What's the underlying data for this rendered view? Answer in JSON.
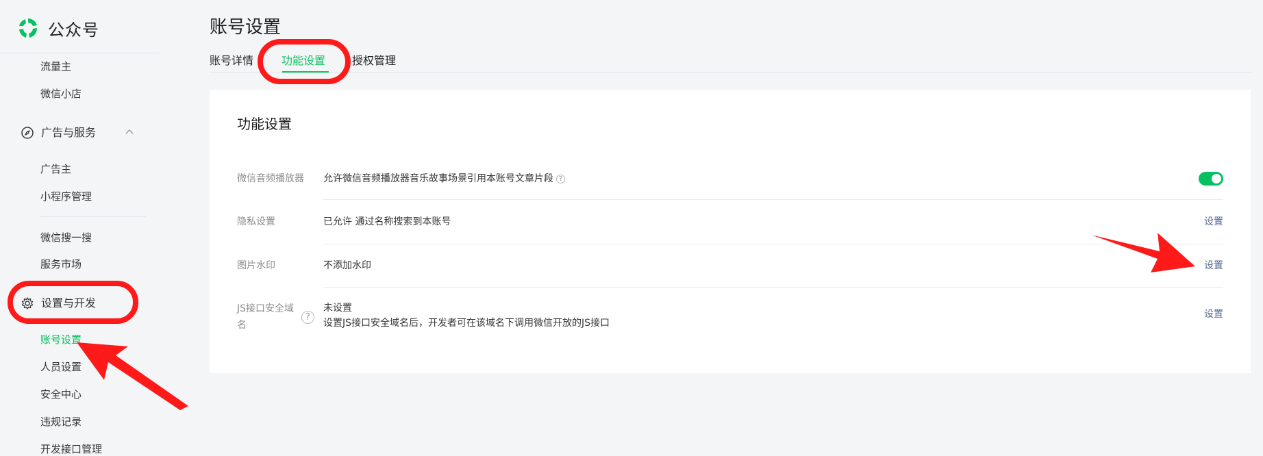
{
  "brand": {
    "name": "公众号",
    "color": "#07c160"
  },
  "sidebar": {
    "items_top": [
      {
        "label": "流量主"
      },
      {
        "label": "微信小店"
      }
    ],
    "group_ads": {
      "label": "广告与服务",
      "icon": "compass-icon",
      "expanded": true
    },
    "ads_items": [
      {
        "label": "广告主"
      },
      {
        "label": "小程序管理"
      },
      {
        "label": "微信搜一搜"
      },
      {
        "label": "服务市场"
      }
    ],
    "group_settings": {
      "label": "设置与开发",
      "icon": "gear-icon"
    },
    "settings_items": [
      {
        "label": "账号设置",
        "active": true
      },
      {
        "label": "人员设置"
      },
      {
        "label": "安全中心"
      },
      {
        "label": "违规记录"
      },
      {
        "label": "开发接口管理"
      }
    ]
  },
  "header": {
    "title": "账号设置",
    "tabs": [
      {
        "label": "账号详情"
      },
      {
        "label": "功能设置",
        "active": true
      },
      {
        "label": "授权管理"
      }
    ]
  },
  "card": {
    "title": "功能设置",
    "rows": [
      {
        "label": "微信音频播放器",
        "value": "允许微信音频播放器音乐故事场景引用本账号文章片段",
        "control": "toggle",
        "toggle_on": true
      },
      {
        "label": "隐私设置",
        "value": "已允许 通过名称搜索到本账号",
        "action": "设置"
      },
      {
        "label": "图片水印",
        "value": "不添加水印",
        "action": "设置"
      },
      {
        "label_line1": "JS接口安全域",
        "label_line2": "名",
        "value": "未设置",
        "desc": "设置JS接口安全域名后，开发者可在该域名下调用微信开放的JS接口",
        "action": "设置"
      }
    ]
  },
  "help_glyph": "?",
  "colors": {
    "accent": "#07c160",
    "link": "#576b95",
    "annotation": "#ff1a1a"
  }
}
